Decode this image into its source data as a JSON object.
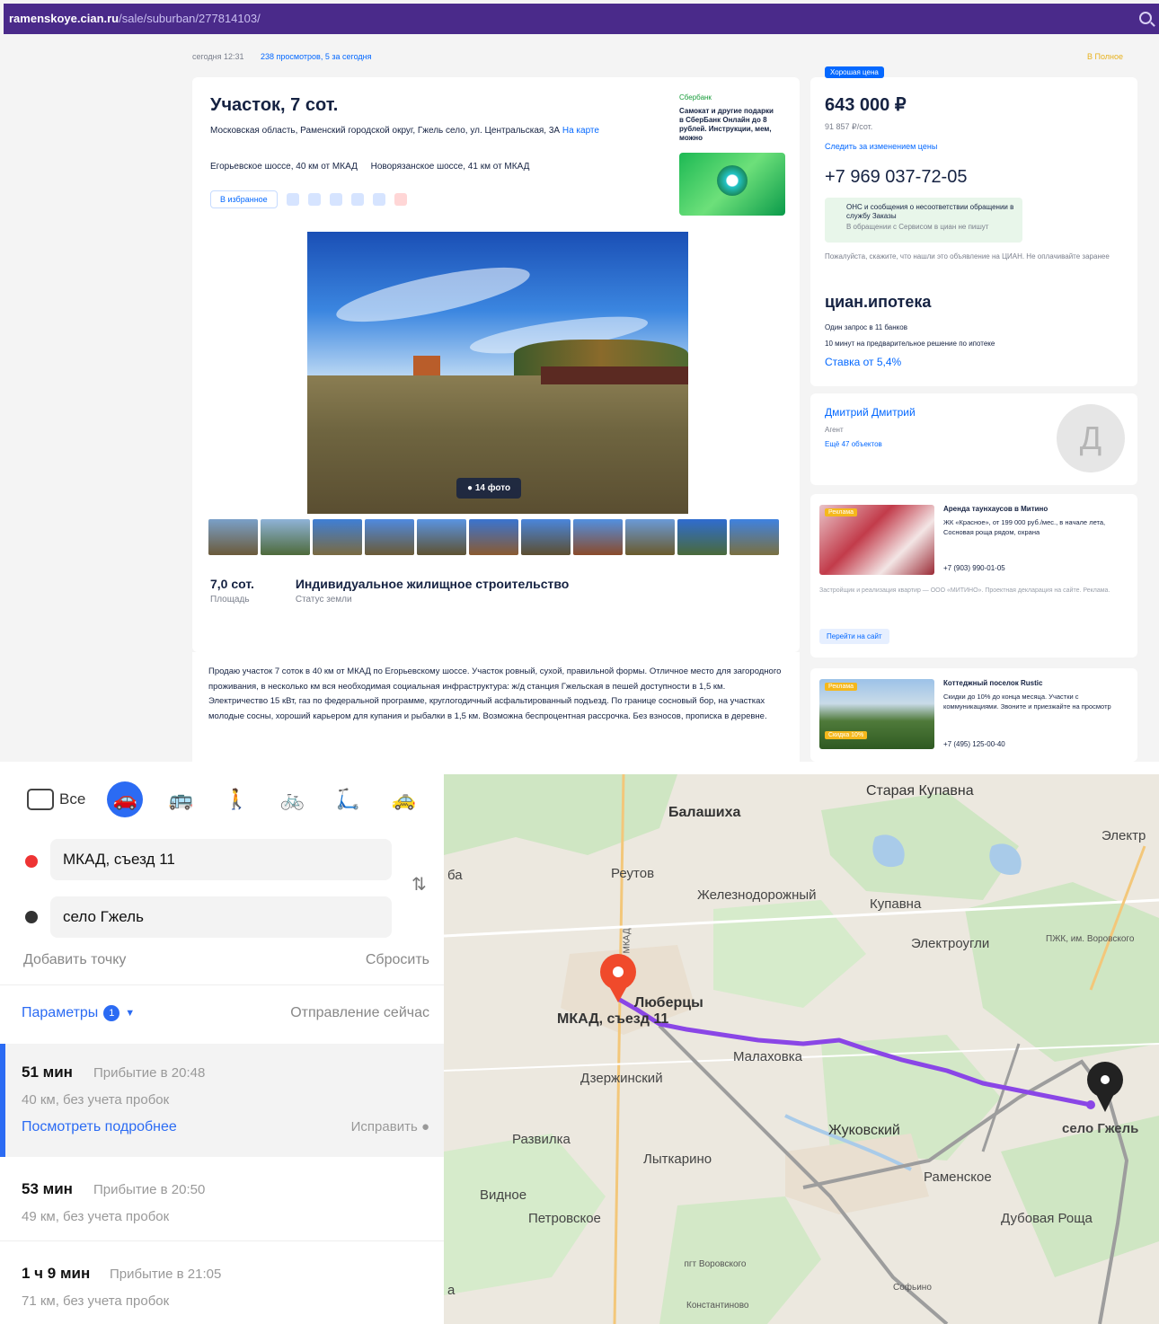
{
  "browser": {
    "url_host": "ramenskoye.cian.ru",
    "url_path": "/sale/suburban/277814103/"
  },
  "listing": {
    "meta_updated": "сегодня 12:31",
    "meta_views": "238 просмотров, 5 за сегодня",
    "fav_top": "В Полное",
    "title": "Участок, 7 сот.",
    "address": "Московская область, Раменский городской округ, Гжель село, ул. Центральская, 3А",
    "address_map_link": "На карте",
    "highway_1": "Егорьевское шоссе, 40 км от МКАД",
    "highway_2": "Новорязанское шоссе, 41 км от МКАД",
    "fav_button": "В избранное",
    "photo_count": "14 фото",
    "area_value": "7,0 сот.",
    "area_label": "Площадь",
    "status_value": "Индивидуальное жилищное строительство",
    "status_label": "Статус земли",
    "description": "Продаю участок 7 соток в 40 км от МКАД по Егорьевскому шоссе. Участок ровный, сухой, правильной формы. Отличное место для загородного проживания, в несколько км вся необходимая социальная инфраструктура: ж/д станция Гжельская в пешей доступности в 1,5 км. Электричество 15 кВт, газ по федеральной программе, круглогодичный асфальтированный подъезд. По границе сосновый бор, на участках молодые сосны, хороший карьером для купания и рыбалки в 1,5 км. Возможна беспроцентная рассрочка. Без взносов, прописка в деревне."
  },
  "bank_ad": {
    "head": "Сбербанк",
    "text": "Самокат и другие подарки в СберБанк Онлайн до 8 рублей. Инструкции, мем, можно"
  },
  "sidebar": {
    "deal_badge": "Хорошая цена",
    "price": "643 000 ₽",
    "price_sub": "91 857 ₽/сот.",
    "watch_price": "Следить за изменением цены",
    "phone": "+7 969 037-72-05",
    "sms_title": "ОНС и сообщения о несоответствии обращении в службу Заказы",
    "sms_sub": "В обращении с Сервисом в циан не пишут",
    "note": "Пожалуйста, скажите, что нашли это объявление на ЦИАН. Не оплачивайте заранее",
    "ipoteka_title": "циан.ипотека",
    "ipoteka_l1": "Один запрос в 11 банков",
    "ipoteka_l2": "10 минут на предварительное решение по ипотеке",
    "ipoteka_rate": "Ставка от 5,4%",
    "agent_name": "Дмитрий Дмитрий",
    "agent_role": "Агент",
    "agent_listings": "Ещё 47 объектов",
    "agent_avatar": "Д"
  },
  "ads": [
    {
      "tag": "Реклама",
      "title": "Аренда таунхаусов в Митино",
      "text": "ЖК «Красное», от 199 000 руб./мес., в начале лета, Сосновая роща рядом, охрана",
      "phone": "+7 (903) 990-01-05",
      "legal": "Застройщик и реализация квартир — ООО «МИТИНО». Проектная декларация на сайте. Реклама.",
      "button": "Перейти на сайт"
    },
    {
      "tag": "Реклама",
      "title": "Коттеджный поселок Rustic",
      "text": "Скидки до 10% до конца месяца. Участки с коммуникациями. Звоните и приезжайте на просмотр",
      "phone": "+7 (495) 125-00-40",
      "extra_badge": "Скидка 10%"
    }
  ],
  "route": {
    "mode_all": "Все",
    "point_a": "МКАД, съезд 11",
    "point_b": "село Гжель",
    "add_point": "Добавить точку",
    "reset": "Сбросить",
    "params": "Параметры",
    "params_count": "1",
    "depart": "Отправление сейчас",
    "options": [
      {
        "time": "51 мин",
        "arrive": "Прибытие в 20:48",
        "dist": "40 км, без учета пробок",
        "details": "Посмотреть подробнее",
        "fix": "Исправить"
      },
      {
        "time": "53 мин",
        "arrive": "Прибытие в 20:50",
        "dist": "49 км, без учета пробок"
      },
      {
        "time": "1 ч 9 мин",
        "arrive": "Прибытие в 21:05",
        "dist": "71 км, без учета пробок"
      }
    ]
  },
  "map": {
    "labels": {
      "staraya_kupavna": "Старая Купавна",
      "balashikha": "Балашиха",
      "elektr": "Электр",
      "reutov": "Реутов",
      "zheleznodorozhny": "Железнодорожный",
      "kupavna": "Купавна",
      "elektrougli": "Электроугли",
      "bronnitsy_area": "ПЖК, им. Воровского",
      "lyubertsy": "Люберцы",
      "mkad_exit": "МКАД, съезд 11",
      "malakhovka": "Малаховка",
      "dzerzhinsky": "Дзержинский",
      "zhukovsky": "Жуковский",
      "selo_gzhel": "село Гжель",
      "razvilka": "Развилка",
      "lytkarino": "Лыткарино",
      "vidnoe": "Видное",
      "ramenskoe": "Раменское",
      "petrovskoe": "Петровское",
      "dubovaya_roscha": "Дубовая Роща",
      "pgt_vorovskogo": "пгт Воровского",
      "konstantinovo": "Константиново",
      "sofyino": "Софьино",
      "mkad": "МКАД",
      "edge_ba": "ба",
      "edge_a": "а"
    }
  }
}
